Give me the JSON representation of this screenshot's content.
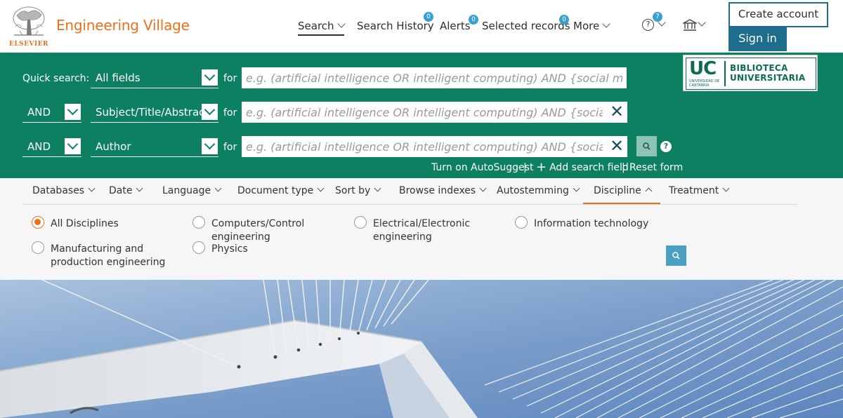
{
  "header": {
    "logo_text": "ELSEVIER",
    "brand": "Engineering Village",
    "nav": {
      "search": "Search",
      "history": "Search History",
      "history_badge": "0",
      "alerts": "Alerts",
      "alerts_badge": "0",
      "selected": "Selected records",
      "selected_badge": "0",
      "more": "More"
    },
    "help_badge": "7",
    "create_account": "Create account",
    "sign_in": "Sign in"
  },
  "search": {
    "quick_label": "Quick search:",
    "for_label": "for",
    "placeholder": "e.g. (artificial intelligence OR intelligent computing) AND {social media}",
    "rows": [
      {
        "field": "All fields"
      },
      {
        "operator": "AND",
        "field": "Subject/Title/Abstract"
      },
      {
        "operator": "AND",
        "field": "Author"
      }
    ],
    "links": {
      "autosuggest": "Turn on AutoSuggest",
      "add_field": "Add search field",
      "reset": "Reset form"
    },
    "institution": {
      "letters": "UC",
      "small": "UNIVERSIDAD DE CANTABRIA",
      "line1": "BIBLIOTECA",
      "line2": "UNIVERSITARIA"
    }
  },
  "filters": {
    "tabs": [
      "Databases",
      "Date",
      "Language",
      "Document type",
      "Sort by",
      "Browse indexes",
      "Autostemming",
      "Discipline",
      "Treatment"
    ],
    "active_tab": "Discipline",
    "disciplines": [
      {
        "label": "All Disciplines",
        "selected": true
      },
      {
        "label": "Computers/Control engineering",
        "selected": false
      },
      {
        "label": "Electrical/Electronic engineering",
        "selected": false
      },
      {
        "label": "Information technology",
        "selected": false
      },
      {
        "label": "Manufacturing and production engineering",
        "selected": false
      },
      {
        "label": "Physics",
        "selected": false
      }
    ]
  },
  "icons": {
    "search_go": "search-icon",
    "help": "question-icon",
    "institution": "institution-icon",
    "clear": "close-icon"
  },
  "colors": {
    "brand_orange": "#e9711c",
    "band_green": "#0e8062",
    "button_blue": "#1f6d8c",
    "badge_blue": "#39a0d4"
  }
}
